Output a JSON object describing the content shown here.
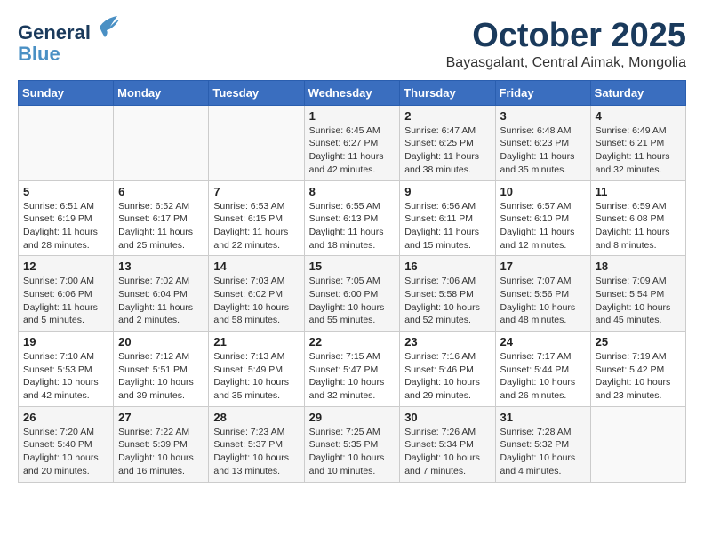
{
  "header": {
    "logo_line1": "General",
    "logo_line2": "Blue",
    "month_title": "October 2025",
    "location": "Bayasgalant, Central Aimak, Mongolia"
  },
  "weekdays": [
    "Sunday",
    "Monday",
    "Tuesday",
    "Wednesday",
    "Thursday",
    "Friday",
    "Saturday"
  ],
  "weeks": [
    [
      {
        "day": "",
        "info": ""
      },
      {
        "day": "",
        "info": ""
      },
      {
        "day": "",
        "info": ""
      },
      {
        "day": "1",
        "info": "Sunrise: 6:45 AM\nSunset: 6:27 PM\nDaylight: 11 hours\nand 42 minutes."
      },
      {
        "day": "2",
        "info": "Sunrise: 6:47 AM\nSunset: 6:25 PM\nDaylight: 11 hours\nand 38 minutes."
      },
      {
        "day": "3",
        "info": "Sunrise: 6:48 AM\nSunset: 6:23 PM\nDaylight: 11 hours\nand 35 minutes."
      },
      {
        "day": "4",
        "info": "Sunrise: 6:49 AM\nSunset: 6:21 PM\nDaylight: 11 hours\nand 32 minutes."
      }
    ],
    [
      {
        "day": "5",
        "info": "Sunrise: 6:51 AM\nSunset: 6:19 PM\nDaylight: 11 hours\nand 28 minutes."
      },
      {
        "day": "6",
        "info": "Sunrise: 6:52 AM\nSunset: 6:17 PM\nDaylight: 11 hours\nand 25 minutes."
      },
      {
        "day": "7",
        "info": "Sunrise: 6:53 AM\nSunset: 6:15 PM\nDaylight: 11 hours\nand 22 minutes."
      },
      {
        "day": "8",
        "info": "Sunrise: 6:55 AM\nSunset: 6:13 PM\nDaylight: 11 hours\nand 18 minutes."
      },
      {
        "day": "9",
        "info": "Sunrise: 6:56 AM\nSunset: 6:11 PM\nDaylight: 11 hours\nand 15 minutes."
      },
      {
        "day": "10",
        "info": "Sunrise: 6:57 AM\nSunset: 6:10 PM\nDaylight: 11 hours\nand 12 minutes."
      },
      {
        "day": "11",
        "info": "Sunrise: 6:59 AM\nSunset: 6:08 PM\nDaylight: 11 hours\nand 8 minutes."
      }
    ],
    [
      {
        "day": "12",
        "info": "Sunrise: 7:00 AM\nSunset: 6:06 PM\nDaylight: 11 hours\nand 5 minutes."
      },
      {
        "day": "13",
        "info": "Sunrise: 7:02 AM\nSunset: 6:04 PM\nDaylight: 11 hours\nand 2 minutes."
      },
      {
        "day": "14",
        "info": "Sunrise: 7:03 AM\nSunset: 6:02 PM\nDaylight: 10 hours\nand 58 minutes."
      },
      {
        "day": "15",
        "info": "Sunrise: 7:05 AM\nSunset: 6:00 PM\nDaylight: 10 hours\nand 55 minutes."
      },
      {
        "day": "16",
        "info": "Sunrise: 7:06 AM\nSunset: 5:58 PM\nDaylight: 10 hours\nand 52 minutes."
      },
      {
        "day": "17",
        "info": "Sunrise: 7:07 AM\nSunset: 5:56 PM\nDaylight: 10 hours\nand 48 minutes."
      },
      {
        "day": "18",
        "info": "Sunrise: 7:09 AM\nSunset: 5:54 PM\nDaylight: 10 hours\nand 45 minutes."
      }
    ],
    [
      {
        "day": "19",
        "info": "Sunrise: 7:10 AM\nSunset: 5:53 PM\nDaylight: 10 hours\nand 42 minutes."
      },
      {
        "day": "20",
        "info": "Sunrise: 7:12 AM\nSunset: 5:51 PM\nDaylight: 10 hours\nand 39 minutes."
      },
      {
        "day": "21",
        "info": "Sunrise: 7:13 AM\nSunset: 5:49 PM\nDaylight: 10 hours\nand 35 minutes."
      },
      {
        "day": "22",
        "info": "Sunrise: 7:15 AM\nSunset: 5:47 PM\nDaylight: 10 hours\nand 32 minutes."
      },
      {
        "day": "23",
        "info": "Sunrise: 7:16 AM\nSunset: 5:46 PM\nDaylight: 10 hours\nand 29 minutes."
      },
      {
        "day": "24",
        "info": "Sunrise: 7:17 AM\nSunset: 5:44 PM\nDaylight: 10 hours\nand 26 minutes."
      },
      {
        "day": "25",
        "info": "Sunrise: 7:19 AM\nSunset: 5:42 PM\nDaylight: 10 hours\nand 23 minutes."
      }
    ],
    [
      {
        "day": "26",
        "info": "Sunrise: 7:20 AM\nSunset: 5:40 PM\nDaylight: 10 hours\nand 20 minutes."
      },
      {
        "day": "27",
        "info": "Sunrise: 7:22 AM\nSunset: 5:39 PM\nDaylight: 10 hours\nand 16 minutes."
      },
      {
        "day": "28",
        "info": "Sunrise: 7:23 AM\nSunset: 5:37 PM\nDaylight: 10 hours\nand 13 minutes."
      },
      {
        "day": "29",
        "info": "Sunrise: 7:25 AM\nSunset: 5:35 PM\nDaylight: 10 hours\nand 10 minutes."
      },
      {
        "day": "30",
        "info": "Sunrise: 7:26 AM\nSunset: 5:34 PM\nDaylight: 10 hours\nand 7 minutes."
      },
      {
        "day": "31",
        "info": "Sunrise: 7:28 AM\nSunset: 5:32 PM\nDaylight: 10 hours\nand 4 minutes."
      },
      {
        "day": "",
        "info": ""
      }
    ]
  ]
}
